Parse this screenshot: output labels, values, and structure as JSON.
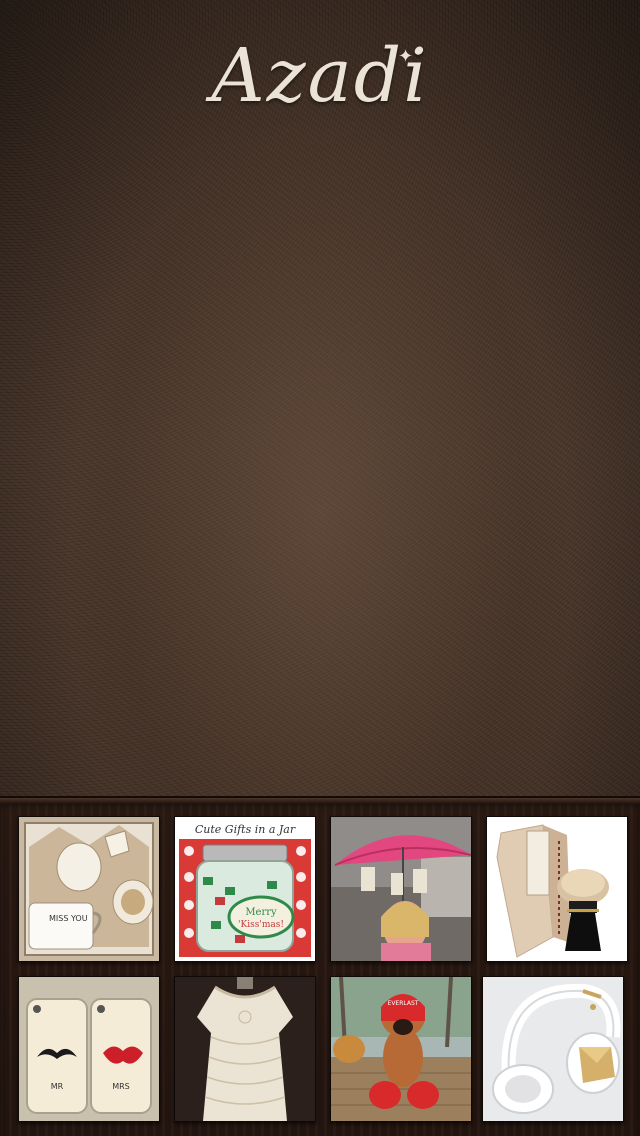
{
  "app": {
    "title": "Azadi"
  },
  "colors": {
    "background": "#3d2c22",
    "logo": "#ebe4d6",
    "tray": "#24150f"
  },
  "gallery": {
    "items": [
      {
        "name": "gift-box-mugs",
        "texts": [
          "MISS YOU"
        ]
      },
      {
        "name": "gifts-in-a-jar",
        "texts": [
          "Cute Gifts in a Jar",
          "Merry",
          "'Kiss'mas!"
        ]
      },
      {
        "name": "girl-pink-umbrella",
        "texts": []
      },
      {
        "name": "shaving-brush-gift",
        "texts": []
      },
      {
        "name": "mr-mrs-phone-cases",
        "texts": [
          "MR",
          "MRS"
        ]
      },
      {
        "name": "lace-dress",
        "texts": []
      },
      {
        "name": "boxer-dog",
        "texts": [
          "EVERLAST"
        ]
      },
      {
        "name": "white-gold-headphones",
        "texts": []
      }
    ]
  }
}
